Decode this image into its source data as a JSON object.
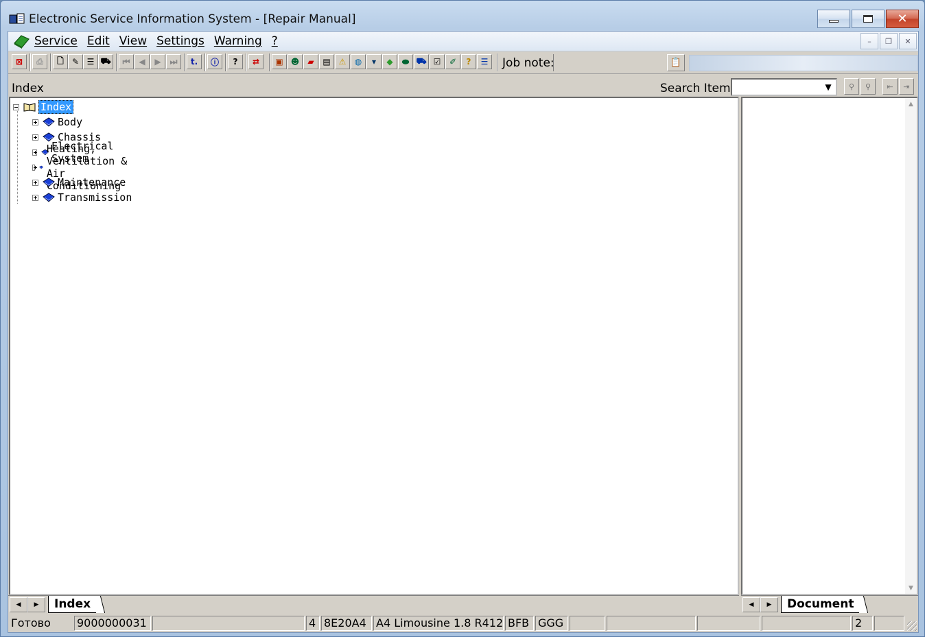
{
  "window": {
    "title": "Electronic Service Information System - [Repair Manual]"
  },
  "menu": {
    "items": [
      "Service",
      "Edit",
      "View",
      "Settings",
      "Warning",
      "?"
    ]
  },
  "toolbar": {
    "job_note_label": "Job note:",
    "job_note_value": ""
  },
  "header": {
    "index_label": "Index",
    "search_label": "Search Item:",
    "search_value": ""
  },
  "tree": {
    "root": "Index",
    "items": [
      "Body",
      "Chassis",
      "Electrical System",
      "Heating, Ventilation & Air Conditioning",
      "Maintenance",
      "Transmission"
    ]
  },
  "tabs": {
    "left": "Index",
    "right": "Document"
  },
  "status": {
    "state": "Готово",
    "number": "9000000031",
    "field3": "4",
    "code": "8E20A4",
    "model": "A4 Limousine 1.8 R412",
    "engine": "BFB",
    "gearbox": "GGG",
    "page": "2"
  },
  "colors": {
    "selection": "#3399ff",
    "book_blue": "#1a3fd6",
    "close_red": "#c2432a",
    "logo_green": "#2e9b2e"
  }
}
